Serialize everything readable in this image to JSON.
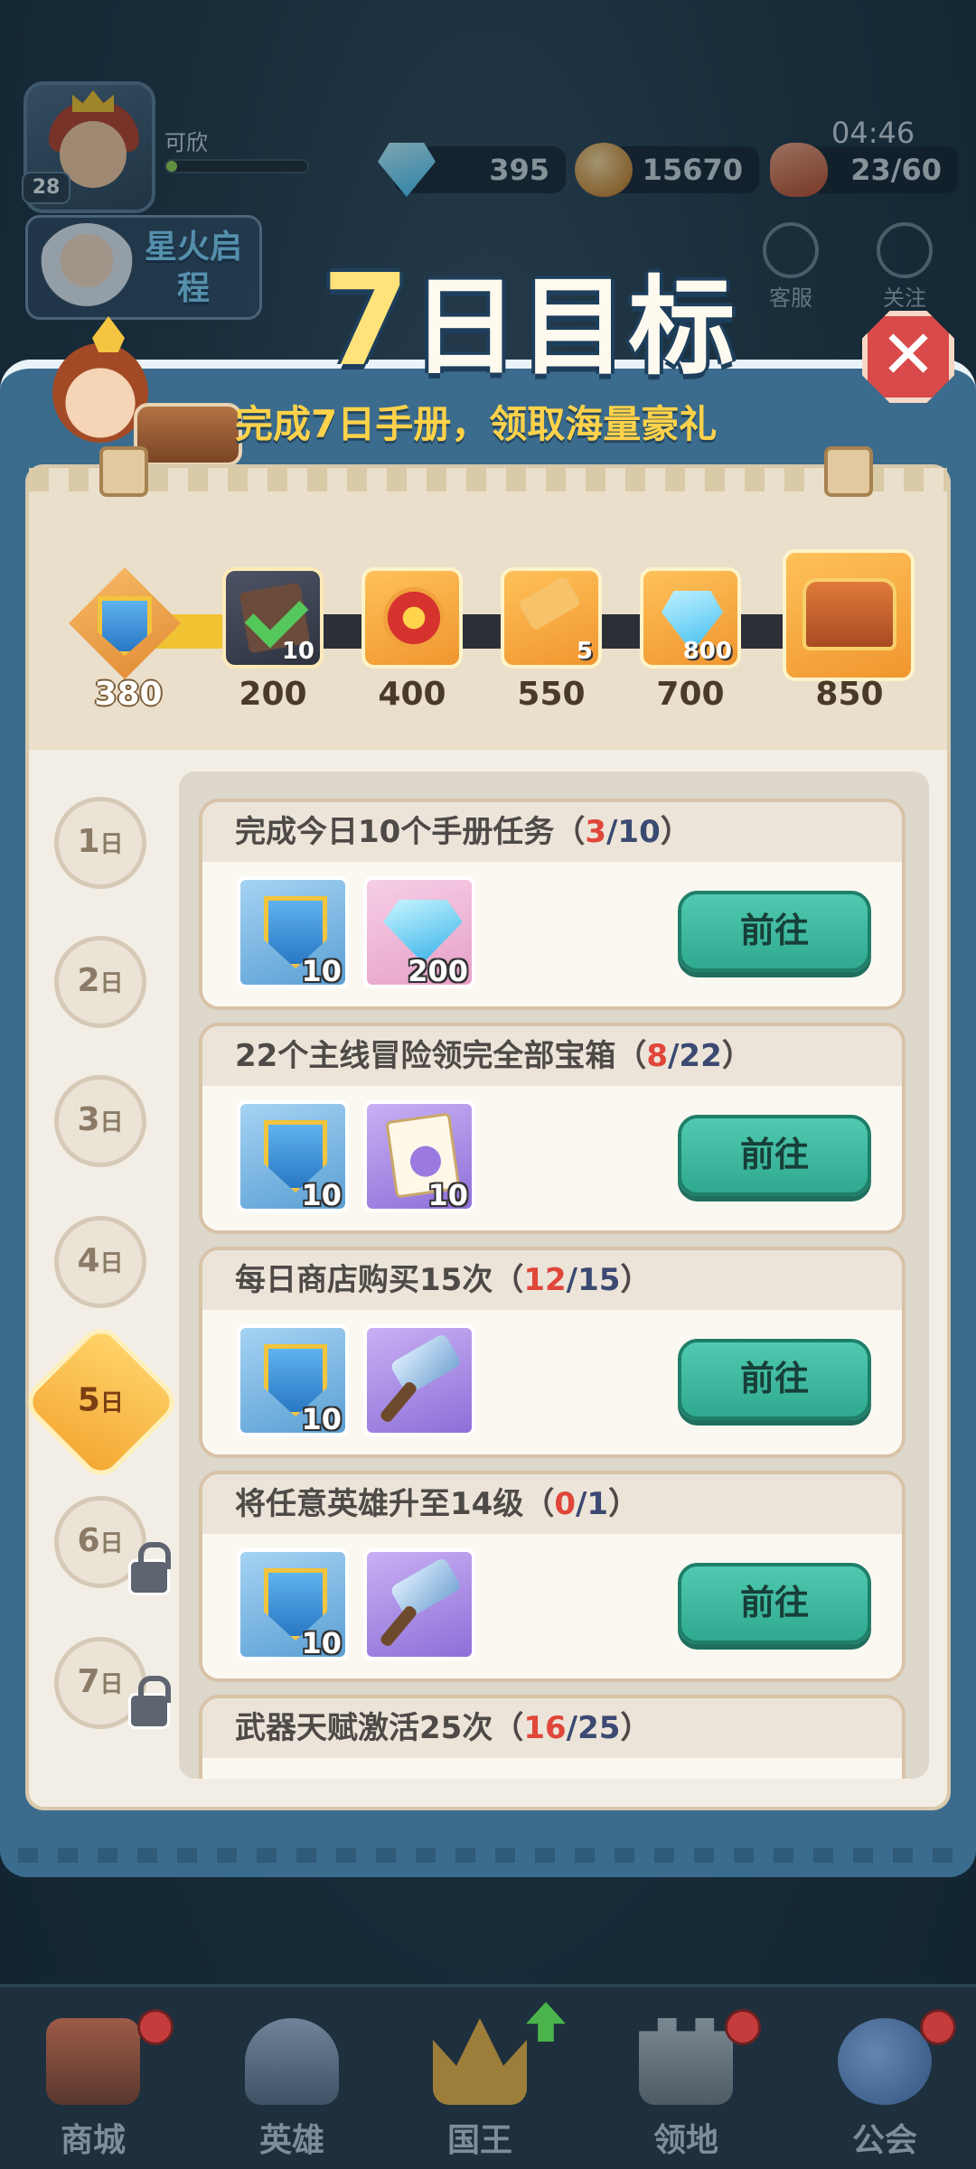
{
  "topbar": {
    "player_name": "可欣",
    "player_level": "28",
    "gems": "395",
    "coins": "15670",
    "time": "04:46",
    "stamina": "23/60",
    "event_banner": "星火启程",
    "customer_service": "客服",
    "follow": "关注"
  },
  "dialog": {
    "title_number": "7",
    "title_text": "日目标",
    "subtitle": "完成7日手册，领取海量豪礼",
    "close_symbol": "✕"
  },
  "milestones": [
    {
      "points": "380",
      "icon": "shield-badge-icon",
      "qty": ""
    },
    {
      "points": "200",
      "icon": "book-claimed-icon",
      "qty": "10"
    },
    {
      "points": "400",
      "icon": "token-icon",
      "qty": ""
    },
    {
      "points": "550",
      "icon": "hammer-icon",
      "qty": "5"
    },
    {
      "points": "700",
      "icon": "diamond-icon",
      "qty": "800"
    },
    {
      "points": "850",
      "icon": "treasure-chest-icon",
      "qty": ""
    }
  ],
  "progress_fraction": 0.22,
  "days": [
    {
      "num": "1",
      "suffix": "日"
    },
    {
      "num": "2",
      "suffix": "日"
    },
    {
      "num": "3",
      "suffix": "日"
    },
    {
      "num": "4",
      "suffix": "日"
    },
    {
      "num": "5",
      "suffix": "日"
    },
    {
      "num": "6",
      "suffix": "日"
    },
    {
      "num": "7",
      "suffix": "日"
    }
  ],
  "tasks": [
    {
      "title": "完成今日10个手册任务（",
      "current": "3",
      "sep": "/",
      "total": "10",
      "close": "）",
      "rewards": [
        {
          "icon": "shield-badge-icon",
          "qty": "10"
        },
        {
          "icon": "diamond-icon",
          "qty": "200"
        }
      ],
      "button": "前往"
    },
    {
      "title": "22个主线冒险领完全部宝箱（",
      "current": "8",
      "sep": "/",
      "total": "22",
      "close": "）",
      "rewards": [
        {
          "icon": "shield-badge-icon",
          "qty": "10"
        },
        {
          "icon": "integral-scroll-icon",
          "qty": "10"
        }
      ],
      "button": "前往"
    },
    {
      "title": "每日商店购买15次（",
      "current": "12",
      "sep": "/",
      "total": "15",
      "close": "）",
      "rewards": [
        {
          "icon": "shield-badge-icon",
          "qty": "10"
        },
        {
          "icon": "hammer-icon",
          "qty": ""
        }
      ],
      "button": "前往"
    },
    {
      "title": "将任意英雄升至14级（",
      "current": "0",
      "sep": "/",
      "total": "1",
      "close": "）",
      "rewards": [
        {
          "icon": "shield-badge-icon",
          "qty": "10"
        },
        {
          "icon": "hammer-icon",
          "qty": ""
        }
      ],
      "button": "前往"
    },
    {
      "title": "武器天赋激活25次（",
      "current": "16",
      "sep": "/",
      "total": "25",
      "close": "）"
    }
  ],
  "nav": [
    {
      "label": "商城",
      "icon": "shop-icon"
    },
    {
      "label": "英雄",
      "icon": "helmet-icon"
    },
    {
      "label": "国王",
      "icon": "crown-icon"
    },
    {
      "label": "领地",
      "icon": "castle-icon"
    },
    {
      "label": "公会",
      "icon": "planet-icon"
    }
  ],
  "colors": {
    "accent_gold": "#f1c232",
    "go_button": "#2fa98f",
    "progress_current": "#e0463a",
    "progress_total": "#3b4a72"
  }
}
